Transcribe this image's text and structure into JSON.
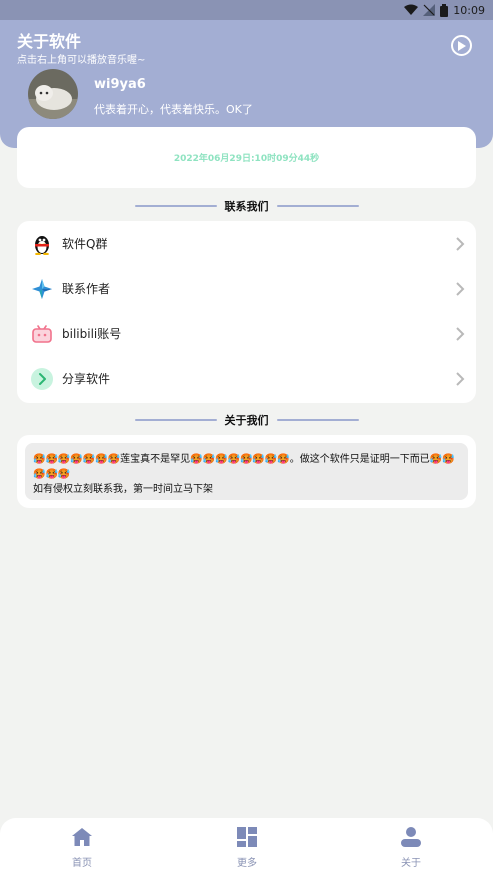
{
  "status_bar": {
    "time": "10:09"
  },
  "header": {
    "title": "关于软件",
    "subtitle": "点击右上角可以播放音乐喔~",
    "username": "wi9ya6",
    "bio": "代表着开心，代表着快乐。OK了"
  },
  "time_card": {
    "datetime": "2022年06月29日:10时09分44秒"
  },
  "contact_section": {
    "title": "联系我们",
    "items": [
      {
        "label": "软件Q群",
        "icon": "qq-penguin-icon"
      },
      {
        "label": "联系作者",
        "icon": "star-sparkle-icon"
      },
      {
        "label": "bilibili账号",
        "icon": "bilibili-tv-icon"
      },
      {
        "label": "分享软件",
        "icon": "share-arrow-icon"
      }
    ]
  },
  "about_section": {
    "title": "关于我们",
    "text": "🥵🥵🥵🥵🥵🥵🥵莲宝真不是罕见🥵🥵🥵🥵🥵🥵🥵🥵。做这个软件只是证明一下而已🥵🥵🥵🥵🥵",
    "text2": "如有侵权立刻联系我，第一时间立马下架"
  },
  "bottom_nav": {
    "items": [
      {
        "label": "首页",
        "icon": "home-icon"
      },
      {
        "label": "更多",
        "icon": "grid-layout-icon"
      },
      {
        "label": "关于",
        "icon": "user-icon"
      }
    ]
  },
  "colors": {
    "header_bg": "#a3aed3",
    "accent_green": "#8fe3c1",
    "nav_text": "#8a93b4"
  }
}
